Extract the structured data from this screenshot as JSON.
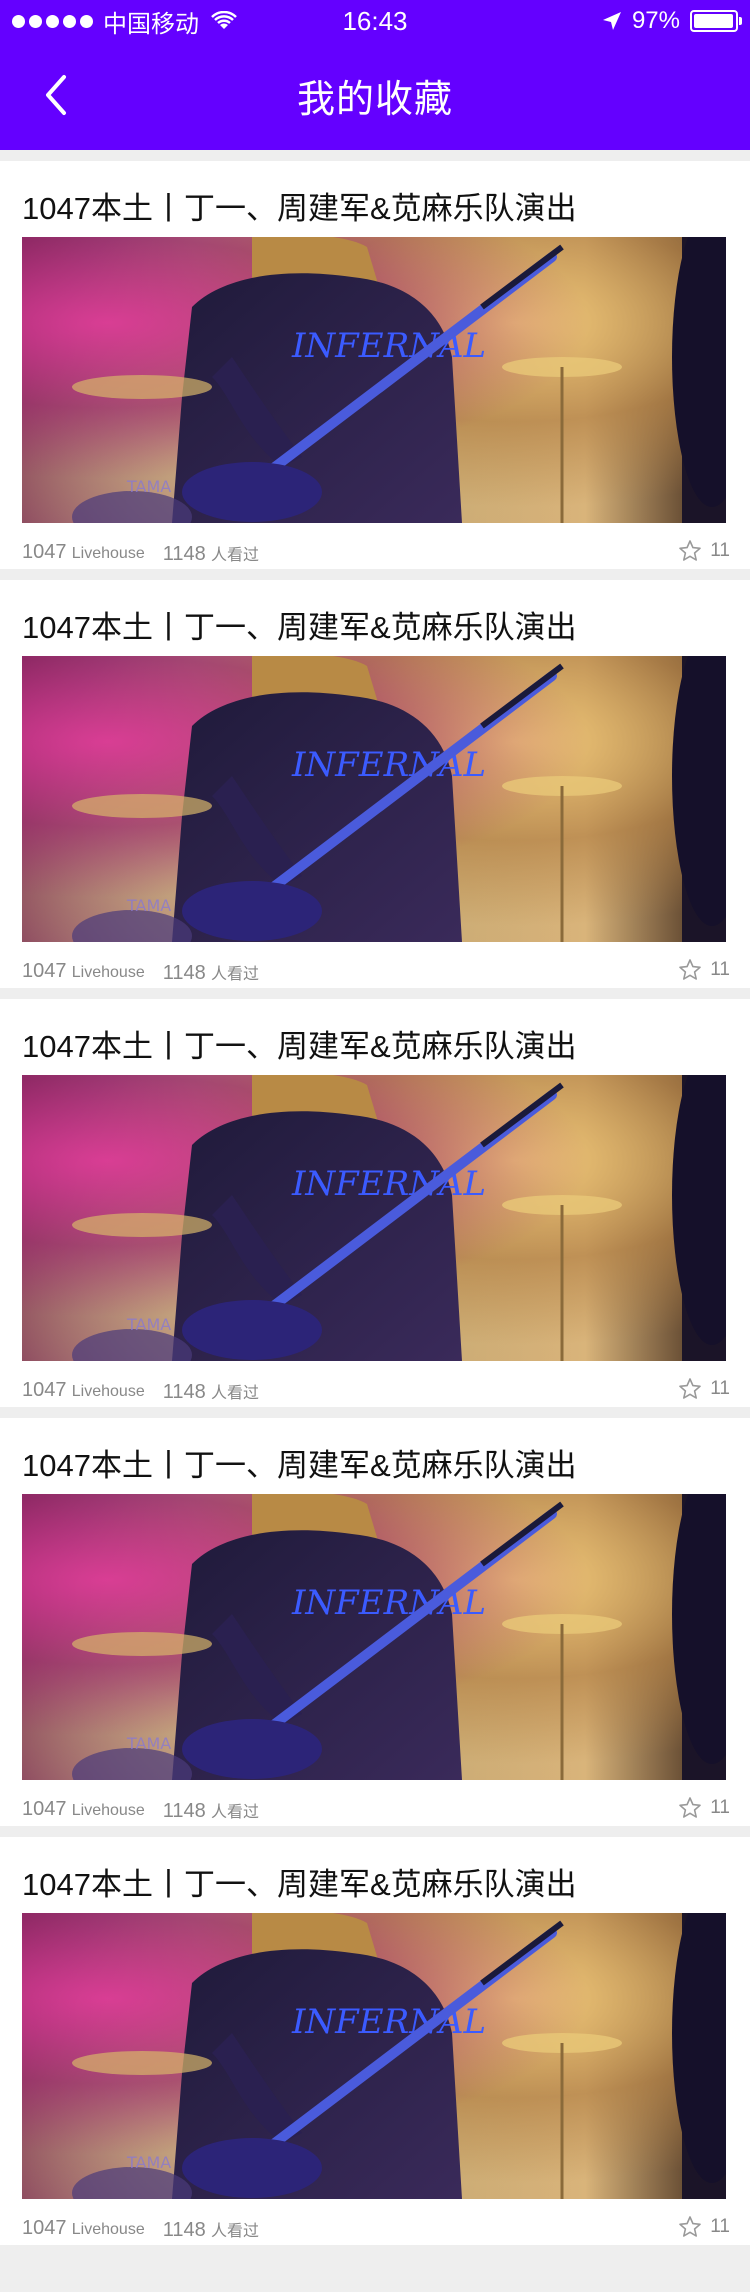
{
  "status_bar": {
    "carrier": "中国移动",
    "time": "16:43",
    "battery": "97%",
    "battery_level": 0.97
  },
  "header": {
    "back_icon": "chevron-left-icon",
    "title": "我的收藏"
  },
  "colors": {
    "header_bg": "#6400ff",
    "page_bg": "#eeeeee"
  },
  "cards": [
    {
      "title": "1047本土丨丁一、周建军&苋麻乐队演出",
      "venue_num": "1047",
      "venue_word": "Livehouse",
      "views_num": "1148",
      "views_word": "人看过",
      "fav_count": "11",
      "fav_icon": "star-outline-icon"
    },
    {
      "title": "1047本土丨丁一、周建军&苋麻乐队演出",
      "venue_num": "1047",
      "venue_word": "Livehouse",
      "views_num": "1148",
      "views_word": "人看过",
      "fav_count": "11",
      "fav_icon": "star-outline-icon"
    },
    {
      "title": "1047本土丨丁一、周建军&苋麻乐队演出",
      "venue_num": "1047",
      "venue_word": "Livehouse",
      "views_num": "1148",
      "views_word": "人看过",
      "fav_count": "11",
      "fav_icon": "star-outline-icon"
    },
    {
      "title": "1047本土丨丁一、周建军&苋麻乐队演出",
      "venue_num": "1047",
      "venue_word": "Livehouse",
      "views_num": "1148",
      "views_word": "人看过",
      "fav_count": "11",
      "fav_icon": "star-outline-icon"
    },
    {
      "title": "1047本土丨丁一、周建军&苋麻乐队演出",
      "venue_num": "1047",
      "venue_word": "Livehouse",
      "views_num": "1148",
      "views_word": "人看过",
      "fav_count": "11",
      "fav_icon": "star-outline-icon"
    }
  ]
}
